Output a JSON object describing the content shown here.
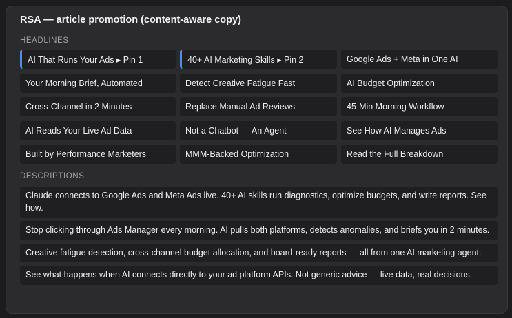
{
  "title": "RSA — article promotion (content-aware copy)",
  "headlines_label": "HEADLINES",
  "descriptions_label": "DESCRIPTIONS",
  "headlines": [
    {
      "text": "AI That Runs Your Ads ▸ Pin 1",
      "pinned": true
    },
    {
      "text": "40+ AI Marketing Skills ▸ Pin 2",
      "pinned": true
    },
    {
      "text": "Google Ads + Meta in One AI",
      "pinned": false
    },
    {
      "text": "Your Morning Brief, Automated",
      "pinned": false
    },
    {
      "text": "Detect Creative Fatigue Fast",
      "pinned": false
    },
    {
      "text": "AI Budget Optimization",
      "pinned": false
    },
    {
      "text": "Cross-Channel in 2 Minutes",
      "pinned": false
    },
    {
      "text": "Replace Manual Ad Reviews",
      "pinned": false
    },
    {
      "text": "45-Min Morning Workflow",
      "pinned": false
    },
    {
      "text": "AI Reads Your Live Ad Data",
      "pinned": false
    },
    {
      "text": "Not a Chatbot — An Agent",
      "pinned": false
    },
    {
      "text": "See How AI Manages Ads",
      "pinned": false
    },
    {
      "text": "Built by Performance Marketers",
      "pinned": false
    },
    {
      "text": "MMM-Backed Optimization",
      "pinned": false
    },
    {
      "text": "Read the Full Breakdown",
      "pinned": false
    }
  ],
  "descriptions": [
    "Claude connects to Google Ads and Meta Ads live. 40+ AI skills run diagnostics, optimize budgets, and write reports. See how.",
    "Stop clicking through Ads Manager every morning. AI pulls both platforms, detects anomalies, and briefs you in 2 minutes.",
    "Creative fatigue detection, cross-channel budget allocation, and board-ready reports — all from one AI marketing agent.",
    "See what happens when AI connects directly to your ad platform APIs. Not generic advice — live data, real decisions."
  ],
  "colors": {
    "pin_accent": "#4a8fe8",
    "panel_bg": "#2b2b2d",
    "cell_bg": "#1f1f21"
  }
}
